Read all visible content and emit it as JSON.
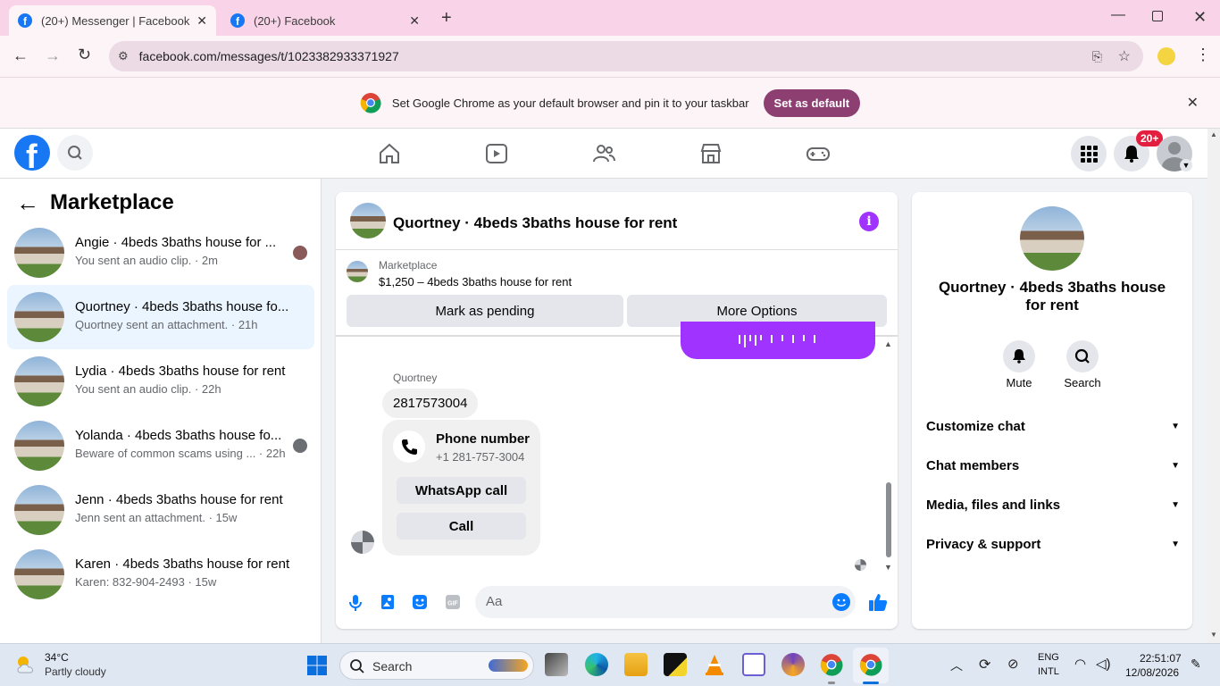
{
  "browser": {
    "tabs": [
      {
        "title": "(20+) Messenger | Facebook",
        "active": true
      },
      {
        "title": "(20+) Facebook",
        "active": false
      }
    ],
    "url": "facebook.com/messages/t/1023382933371927",
    "infobar_text": "Set Google Chrome as your default browser and pin it to your taskbar",
    "infobar_button": "Set as default"
  },
  "fb_header": {
    "notification_badge": "20+",
    "brand_color": "#1877f2"
  },
  "left_pane": {
    "title": "Marketplace",
    "conversations": [
      {
        "name": "Angie · 4beds 3baths house for ...",
        "snippet": "You sent an audio clip. · 2m",
        "selected": false
      },
      {
        "name": "Quortney · 4beds 3baths house fo...",
        "snippet": "Quortney sent an attachment. · 21h",
        "selected": true
      },
      {
        "name": "Lydia · 4beds 3baths house for rent",
        "snippet": "You sent an audio clip. · 22h",
        "selected": false
      },
      {
        "name": "Yolanda · 4beds 3baths house fo...",
        "snippet": "Beware of common scams using ... · 22h",
        "selected": false
      },
      {
        "name": "Jenn · 4beds 3baths house for rent",
        "snippet": "Jenn sent an attachment. · 15w",
        "selected": false
      },
      {
        "name": "Karen · 4beds 3baths house for rent",
        "snippet": "Karen: 832-904-2493 · 15w",
        "selected": false
      }
    ]
  },
  "chat": {
    "title": "Quortney · 4beds 3baths house for rent",
    "listing_source": "Marketplace",
    "listing_text": "$1,250 – 4beds 3baths house for rent",
    "mark_pending": "Mark as pending",
    "more_options": "More Options",
    "sender": "Quortney",
    "message_text": "2817573004",
    "phone_card_title": "Phone number",
    "phone_card_number": "+1 281-757-3004",
    "whatsapp_call": "WhatsApp call",
    "call": "Call",
    "composer_placeholder": "Aa",
    "accent_color": "#a033ff"
  },
  "right_pane": {
    "name": "Quortney · 4beds 3baths house for rent",
    "mute_label": "Mute",
    "search_label": "Search",
    "menu": [
      "Customize chat",
      "Chat members",
      "Media, files and links",
      "Privacy & support"
    ]
  },
  "taskbar": {
    "temperature": "34°C",
    "weather": "Partly cloudy",
    "search_placeholder": "Search",
    "lang_top": "ENG",
    "lang_bottom": "INTL",
    "time": "22:51:07",
    "date": "12/08/2026"
  }
}
